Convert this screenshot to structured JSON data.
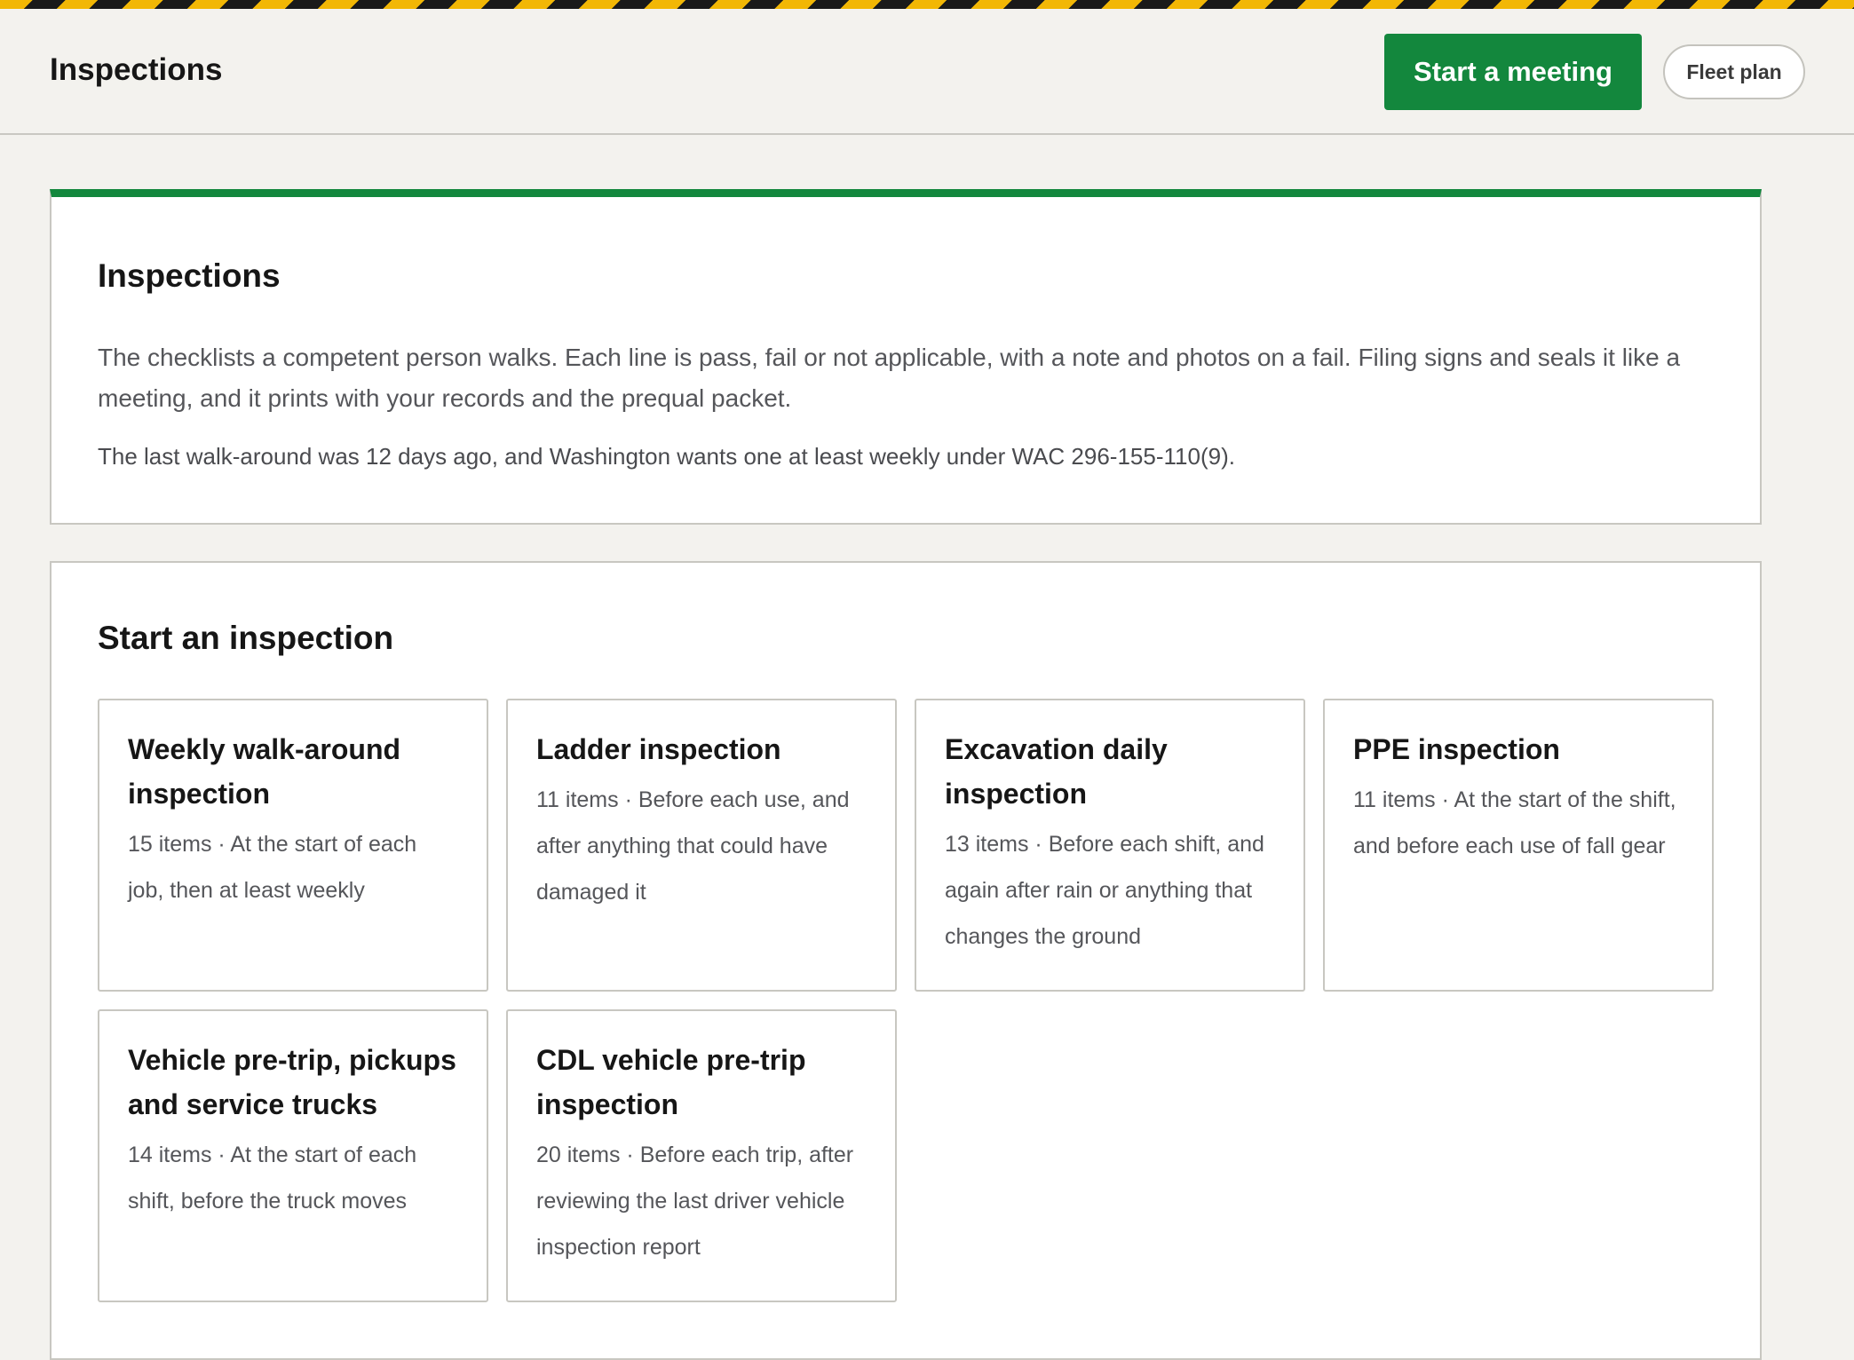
{
  "header": {
    "title": "Inspections",
    "start_meeting_label": "Start a meeting",
    "fleet_plan_label": "Fleet plan"
  },
  "intro": {
    "title": "Inspections",
    "body": "The checklists a competent person walks. Each line is pass, fail or not applicable, with a note and photos on a fail. Filing signs and seals it like a meeting, and it prints with your records and the prequal packet.",
    "note": "The last walk-around was 12 days ago, and Washington wants one at least weekly under WAC 296-155-110(9)."
  },
  "start": {
    "title": "Start an inspection",
    "cards": [
      {
        "title": "Weekly walk-around inspection",
        "meta": "15 items · At the start of each job, then at least weekly"
      },
      {
        "title": "Ladder inspection",
        "meta": "11 items · Before each use, and after anything that could have damaged it"
      },
      {
        "title": "Excavation daily inspection",
        "meta": "13 items · Before each shift, and again after rain or anything that changes the ground"
      },
      {
        "title": "PPE inspection",
        "meta": "11 items · At the start of the shift, and before each use of fall gear"
      },
      {
        "title": "Vehicle pre-trip, pickups and service trucks",
        "meta": "14 items · At the start of each shift, before the truck moves"
      },
      {
        "title": "CDL vehicle pre-trip inspection",
        "meta": "20 items · Before each trip, after reviewing the last driver vehicle inspection report"
      }
    ]
  },
  "colors": {
    "accent_green": "#13873d",
    "hazard_yellow": "#f2b705",
    "hazard_black": "#1a1a1a",
    "page_background": "#f3f2ee"
  }
}
